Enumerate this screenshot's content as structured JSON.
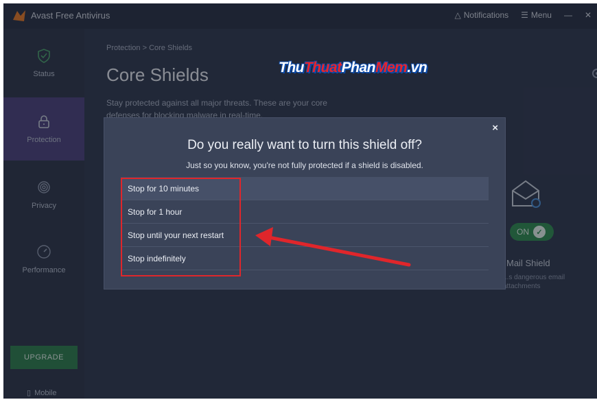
{
  "app": {
    "title": "Avast Free Antivirus"
  },
  "titlebar": {
    "notifications_label": "Notifications",
    "menu_label": "Menu"
  },
  "sidebar": {
    "items": [
      {
        "label": "Status",
        "icon": "shield-check-icon"
      },
      {
        "label": "Protection",
        "icon": "lock-icon",
        "active": true
      },
      {
        "label": "Privacy",
        "icon": "fingerprint-icon"
      },
      {
        "label": "Performance",
        "icon": "speedometer-icon"
      }
    ],
    "upgrade_label": "UPGRADE",
    "mobile_label": "Mobile"
  },
  "main": {
    "breadcrumb": "Protection  >  Core Shields",
    "title": "Core Shields",
    "description": "Stay protected against all major threats. These are your core defenses for blocking malware in real-time.",
    "toggle_label": "ON",
    "shield_name": "Mail Shield",
    "shield_desc": "...s dangerous email attachments"
  },
  "watermark": {
    "part1": "Thu",
    "part2": "Thuat",
    "part3": "Phan",
    "part4": "Mem",
    "part5": ".vn"
  },
  "dialog": {
    "title": "Do you really want to turn this shield off?",
    "subtitle": "Just so you know, you're not fully protected if a shield is disabled.",
    "close_glyph": "×",
    "options": [
      "Stop for 10 minutes",
      "Stop for 1 hour",
      "Stop until your next restart",
      "Stop indefinitely"
    ]
  },
  "colors": {
    "accent_red": "#e0262b",
    "toggle_green": "#2c8a4e",
    "background": "#2d364c"
  }
}
